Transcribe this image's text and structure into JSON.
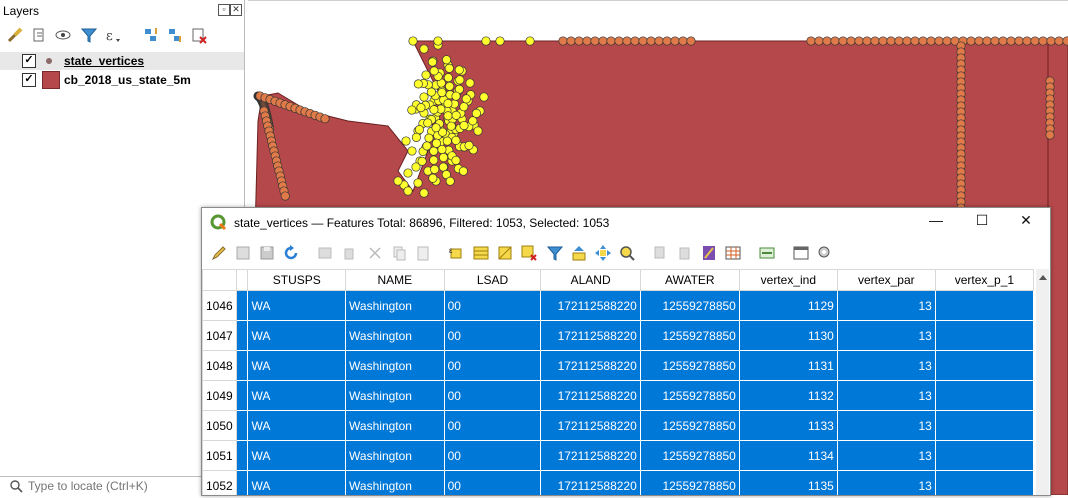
{
  "layers_panel": {
    "title": "Layers",
    "layers": [
      {
        "name": "state_vertices",
        "checked": "✓",
        "selected": true,
        "symbol_color": "#8a6a6a"
      },
      {
        "name": "cb_2018_us_state_5m",
        "checked": "✓",
        "selected": false,
        "symbol_color": "#b5484a"
      }
    ],
    "locator_placeholder": "Type to locate (Ctrl+K)"
  },
  "colors": {
    "state_fill": "#b5484a",
    "vertex_orange": "#e07b49",
    "vertex_yellow": "#ffff2e",
    "selection": "#0078d7"
  },
  "attribute_table": {
    "title": "state_vertices — Features Total: 86896, Filtered: 1053, Selected: 1053",
    "window_controls": {
      "minimize": "—",
      "maximize": "☐",
      "close": "✕"
    },
    "columns": [
      "STUSPS",
      "NAME",
      "LSAD",
      "ALAND",
      "AWATER",
      "vertex_ind",
      "vertex_par",
      "vertex_p_1"
    ],
    "rows": [
      {
        "id": "1046",
        "cells": [
          "WA",
          "Washington",
          "00",
          "172112588220",
          "12559278850",
          "1129",
          "13",
          ""
        ]
      },
      {
        "id": "1047",
        "cells": [
          "WA",
          "Washington",
          "00",
          "172112588220",
          "12559278850",
          "1130",
          "13",
          ""
        ]
      },
      {
        "id": "1048",
        "cells": [
          "WA",
          "Washington",
          "00",
          "172112588220",
          "12559278850",
          "1131",
          "13",
          ""
        ]
      },
      {
        "id": "1049",
        "cells": [
          "WA",
          "Washington",
          "00",
          "172112588220",
          "12559278850",
          "1132",
          "13",
          ""
        ]
      },
      {
        "id": "1050",
        "cells": [
          "WA",
          "Washington",
          "00",
          "172112588220",
          "12559278850",
          "1133",
          "13",
          ""
        ]
      },
      {
        "id": "1051",
        "cells": [
          "WA",
          "Washington",
          "00",
          "172112588220",
          "12559278850",
          "1134",
          "13",
          ""
        ]
      },
      {
        "id": "1052",
        "cells": [
          "WA",
          "Washington",
          "00",
          "172112588220",
          "12559278850",
          "1135",
          "13",
          ""
        ]
      }
    ]
  }
}
